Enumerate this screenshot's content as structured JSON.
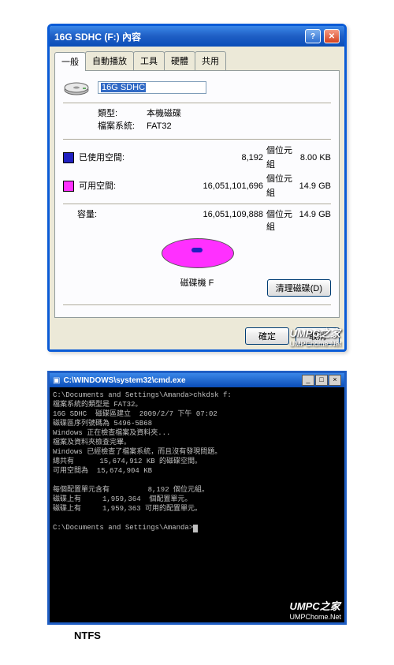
{
  "dialog": {
    "title": "16G SDHC (F:) 內容",
    "tabs": [
      "一般",
      "自動播放",
      "工具",
      "硬體",
      "共用"
    ],
    "volume_label": "16G SDHC",
    "type_label": "類型:",
    "type_value": "本機磁碟",
    "fs_label": "檔案系統:",
    "fs_value": "FAT32",
    "used_label": "已使用空間:",
    "used_bytes": "8,192",
    "bytes_unit": "個位元組",
    "used_hr": "8.00 KB",
    "free_label": "可用空間:",
    "free_bytes": "16,051,101,696",
    "free_hr": "14.9 GB",
    "capacity_label": "容量:",
    "capacity_bytes": "16,051,109,888",
    "capacity_hr": "14.9 GB",
    "drive_caption": "磁碟機 F",
    "cleanup_btn": "清理磁碟(D)",
    "ok_btn": "確定",
    "cancel_btn": "取消"
  },
  "watermark": {
    "title": "UMPC之家",
    "sub": "UMPChome.Net"
  },
  "cmd": {
    "title": "C:\\WINDOWS\\system32\\cmd.exe",
    "lines": [
      "C:\\Documents and Settings\\Amanda>chkdsk f:",
      "檔案系統的類型是 FAT32。",
      "16G SDHC  磁碟區建立  2009/2/7 下午 07:02",
      "磁碟區序列號碼為 5496-5B68",
      "Windows 正在檢查檔案及資料夾...",
      "檔案及資料夾檢查完畢。",
      "Windows 已經檢查了檔案系統，而且沒有發現問題。",
      "總共有      15,674,912 KB 的磁碟空間。",
      "可用空間為  15,674,904 KB",
      "",
      "每個配置單元含有         8,192 個位元組。",
      "磁碟上有     1,959,364  個配置單元。",
      "磁碟上有     1,959,363 可用的配置單元。",
      "",
      "C:\\Documents and Settings\\Amanda>"
    ]
  },
  "footer_label": "NTFS"
}
